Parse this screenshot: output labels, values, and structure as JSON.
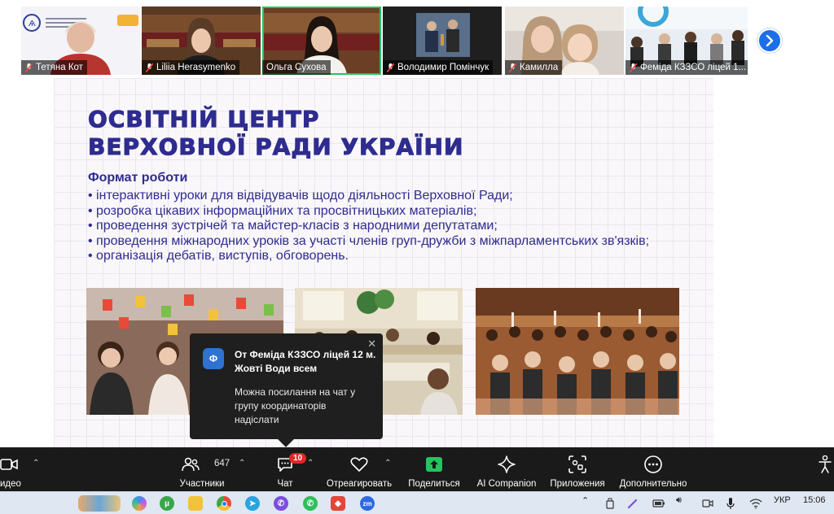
{
  "participants_strip": {
    "tiles": [
      {
        "name": "Тетяна Кот",
        "muted": true
      },
      {
        "name": "Liliia Herasymenko",
        "muted": true
      },
      {
        "name": "Ольга Сухова",
        "muted": false,
        "active_speaker": true
      },
      {
        "name": "Володимир Помінчук",
        "muted": true
      },
      {
        "name": "Камилла",
        "muted": true
      },
      {
        "name": "Феміда КЗЗСО ліцей 1...",
        "muted": true
      }
    ],
    "next_page_icon": "chevron-right-icon"
  },
  "slide": {
    "title_line1": "ОСВІТНІЙ ЦЕНТР",
    "title_line2": "ВЕРХОВНОЇ РАДИ УКРАЇНИ",
    "subtitle": "Формат роботи",
    "bullets": [
      "інтерактивні уроки для відвідувачів щодо діяльності Верховної Ради;",
      "розробка цікавих інформаційних та просвітницьких матеріалів;",
      "проведення зустрічей та майстер-класів з народними депутатами;",
      "проведення міжнародних уроків за участі членів груп-дружби з міжпарламентських зв'язків;",
      "організація дебатів, виступів, обговорень."
    ],
    "title_color": "#2e2c8f"
  },
  "chat_toast": {
    "avatar_letter": "Ф",
    "sender_line": "От Феміда КЗЗСО ліцей 12 м. Жовті Води всем",
    "message": "Можна посилання на чат у групу координаторів надіслати",
    "close_glyph": "✕"
  },
  "toolbar": {
    "video_label": "идео",
    "participants_label": "Участники",
    "participants_count": "647",
    "chat_label": "Чат",
    "chat_badge": "10",
    "reactions_label": "Отреагировать",
    "share_label": "Поделиться",
    "ai_label": "AI Companion",
    "apps_label": "Приложения",
    "more_label": "Дополнительно",
    "share_color": "#22c55e"
  },
  "taskbar": {
    "apps": [
      "copilot",
      "utorrent",
      "file-explorer",
      "chrome",
      "telegram",
      "viber",
      "whatsapp",
      "anydesk",
      "zoom"
    ],
    "zoom_label": "zm",
    "language": "УКР",
    "time": "15:06"
  }
}
